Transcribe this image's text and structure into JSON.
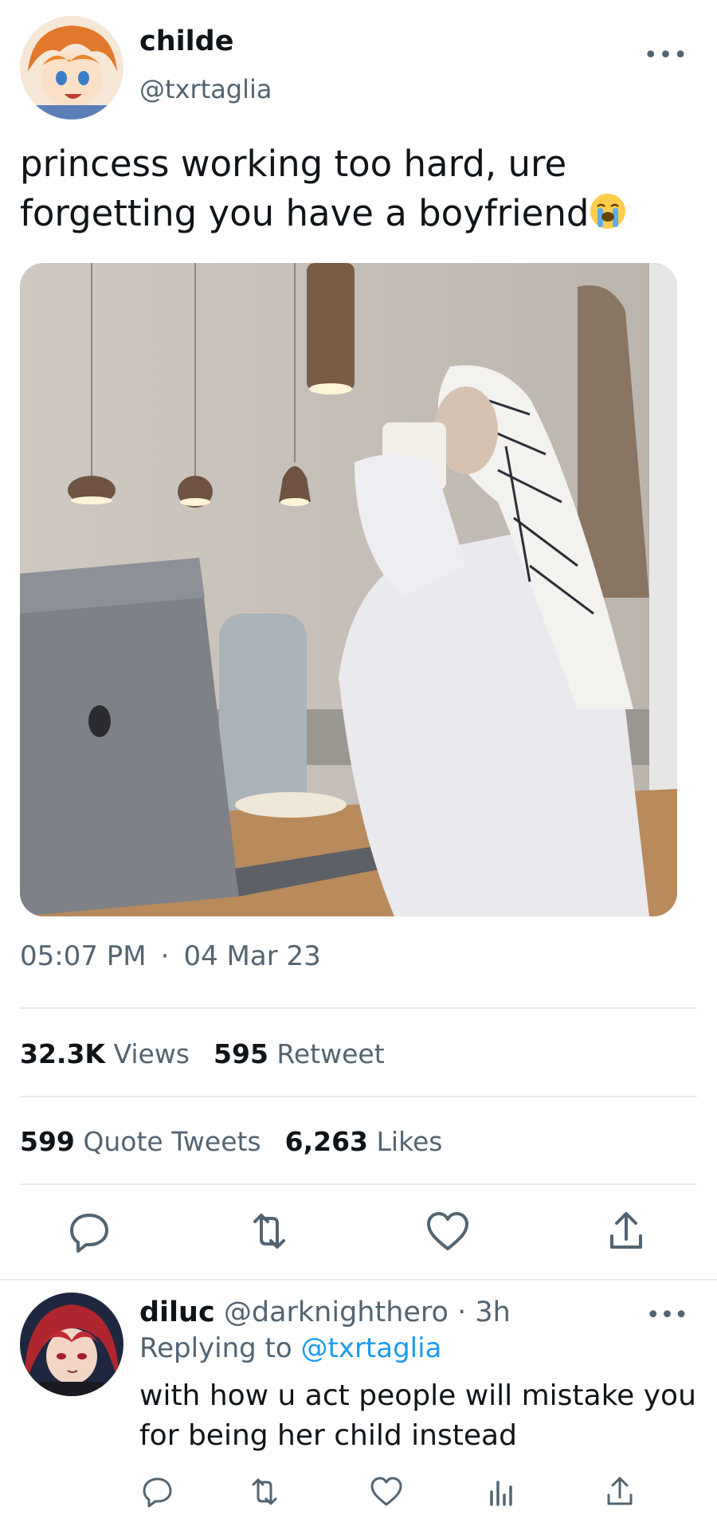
{
  "tweet": {
    "name": "childe",
    "handle": "@txrtaglia",
    "text": "princess working too hard, ure forgetting you have a boyfriend",
    "emoji": "loudly-crying-face",
    "time": "05:07 PM",
    "separator": "·",
    "date": "04 Mar 23",
    "more_label": "•••",
    "stats": {
      "views_count": "32.3K",
      "views_label": "Views",
      "retweets_count": "595",
      "retweets_label": "Retweet",
      "quotes_count": "599",
      "quotes_label": "Quote Tweets",
      "likes_count": "6,263",
      "likes_label": "Likes"
    },
    "actions": [
      "reply-icon",
      "retweet-icon",
      "like-icon",
      "share-icon"
    ]
  },
  "reply": {
    "name": "diluc",
    "handle": "@darknighthero",
    "time_ago": "· 3h",
    "replying_prefix": "Replying to",
    "replying_to": "@txrtaglia",
    "text": "with how u act people will mistake you for being her child instead",
    "more_label": "•••",
    "actions": [
      "reply-icon",
      "retweet-icon",
      "like-icon",
      "views-icon",
      "share-icon"
    ]
  },
  "colors": {
    "text": "#0f1419",
    "secondary": "#536471",
    "link": "#1d9bf0",
    "divider": "#e8ecef"
  }
}
